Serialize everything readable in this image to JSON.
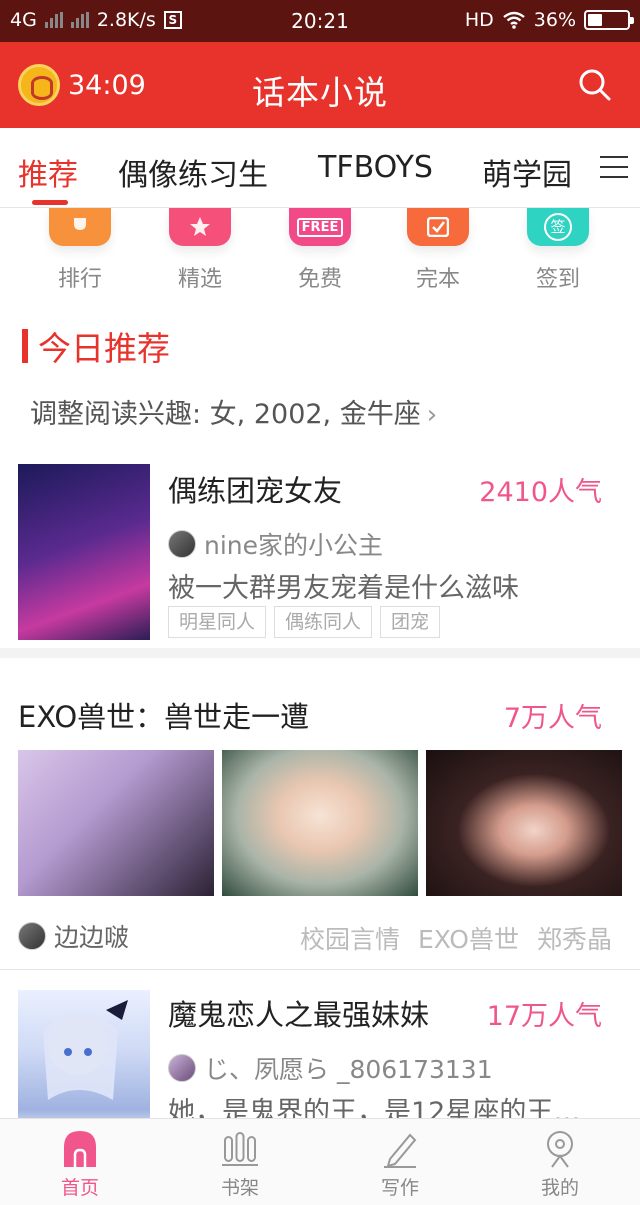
{
  "status_bar": {
    "network": "4G",
    "speed": "2.8K/s",
    "s_badge": "S",
    "time": "20:21",
    "hd": "HD",
    "battery": "36%"
  },
  "header": {
    "timer": "34:09",
    "title": "话本小说"
  },
  "tabs": [
    {
      "label": "推荐",
      "active": true
    },
    {
      "label": "偶像练习生"
    },
    {
      "label": "TFBOYS"
    },
    {
      "label": "萌学园"
    }
  ],
  "quick_entries": [
    {
      "label": "排行",
      "color": "#f7913b"
    },
    {
      "label": "精选",
      "color": "#f5507a"
    },
    {
      "label": "免费",
      "color": "#f24a86",
      "badge": "FREE"
    },
    {
      "label": "完本",
      "color": "#f76a3c"
    },
    {
      "label": "签到",
      "color": "#2fd3c2",
      "badge": "签"
    }
  ],
  "section": {
    "title": "今日推荐",
    "interest": "调整阅读兴趣: 女, 2002, 金牛座",
    "chevron": "›"
  },
  "books": [
    {
      "title": "偶练团宠女友",
      "popularity": "2410人气",
      "author": "nine家的小公主",
      "desc": "被一大群男友宠着是什么滋味",
      "tags": [
        "明星同人",
        "偶练同人",
        "团宠"
      ]
    },
    {
      "title": "EXO兽世：兽世走一遭",
      "popularity": "7万人气",
      "author": "边边啵",
      "tags": [
        "校园言情",
        "EXO兽世",
        "郑秀晶"
      ]
    },
    {
      "title": "魔鬼恋人之最强妹妹",
      "popularity": "17万人气",
      "author": "じ、夙愿ら _806173131",
      "desc": "她，是鬼界的王，是12星座的王…"
    }
  ],
  "bottom_nav": [
    {
      "label": "首页",
      "active": true
    },
    {
      "label": "书架"
    },
    {
      "label": "写作"
    },
    {
      "label": "我的"
    }
  ],
  "colors": {
    "brand_red": "#e8322c",
    "pink": "#f0568b"
  }
}
